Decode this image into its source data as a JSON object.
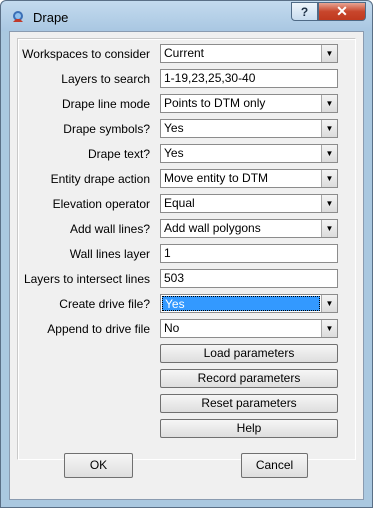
{
  "window": {
    "title": "Drape",
    "help_label": "?",
    "close_label": "✕"
  },
  "rows": [
    {
      "label": "Workspaces to consider",
      "type": "combo",
      "value": "Current"
    },
    {
      "label": "Layers to search",
      "type": "text",
      "value": "1-19,23,25,30-40"
    },
    {
      "label": "Drape line mode",
      "type": "combo",
      "value": "Points to DTM only"
    },
    {
      "label": "Drape symbols?",
      "type": "combo",
      "value": "Yes"
    },
    {
      "label": "Drape text?",
      "type": "combo",
      "value": "Yes"
    },
    {
      "label": "Entity drape action",
      "type": "combo",
      "value": "Move entity to DTM"
    },
    {
      "label": "Elevation operator",
      "type": "combo",
      "value": "Equal"
    },
    {
      "label": "Add wall lines?",
      "type": "combo",
      "value": "Add wall polygons"
    },
    {
      "label": "Wall lines layer",
      "type": "text",
      "value": "1"
    },
    {
      "label": "Layers to intersect lines",
      "type": "text",
      "value": "503"
    },
    {
      "label": "Create drive file?",
      "type": "combo",
      "value": "Yes",
      "selected": true
    },
    {
      "label": "Append to drive file",
      "type": "combo",
      "value": "No"
    }
  ],
  "buttons": {
    "load": "Load parameters",
    "record": "Record parameters",
    "reset": "Reset parameters",
    "help": "Help",
    "ok": "OK",
    "cancel": "Cancel"
  },
  "colors": {
    "accent": "#3399ff",
    "frame": "#aac8e0",
    "close": "#c8462c"
  }
}
